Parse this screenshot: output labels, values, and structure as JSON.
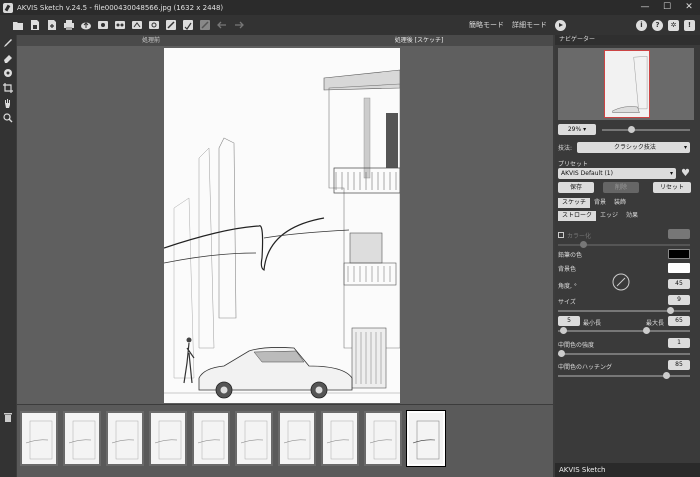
{
  "window": {
    "title": "AKVIS Sketch v.24.5 - file000430048566.jpg (1632 x 2448)",
    "controls": [
      "—",
      "☐",
      "✕"
    ]
  },
  "toolbar": {
    "icons": [
      "open-icon",
      "save-icon",
      "export-icon",
      "print-icon",
      "upload-icon",
      "batch-icon",
      "presets-icon",
      "share-icon",
      "settings-icon",
      "sketch-icon",
      "effect-icon",
      "undo-icon",
      "redo-icon"
    ],
    "mode_express": "簡略モード",
    "mode_advanced": "詳細モード"
  },
  "workspace": {
    "tab_before": "処理前",
    "tab_after": "処理後 [スケッチ]"
  },
  "thumbnails": {
    "count": 10,
    "active_index": 9
  },
  "panel": {
    "navigator_title": "ナビゲーター",
    "zoom_value": "29%",
    "style_label": "技法:",
    "style_value": "クラシック技法",
    "preset_label": "プリセット",
    "preset_value": "AKVIS Default (1)",
    "save_btn": "保存",
    "delete_btn": "削除",
    "reset_btn": "リセット",
    "main_tabs": [
      "スケッチ",
      "背景",
      "装飾"
    ],
    "sub_tabs": [
      "ストローク",
      "エッジ",
      "効果"
    ],
    "color_mode_label": "カラー化",
    "pencil_color_label": "鉛筆の色",
    "bg_color_label": "背景色",
    "angle_label": "角度, °",
    "angle_value": "45",
    "size_label": "サイズ",
    "size_value": "9",
    "min_length_value": "5",
    "min_length_label": "最小長",
    "max_length_label": "最大長",
    "max_length_value": "65",
    "midtone_intensity_label": "中間色の強度",
    "midtone_intensity_value": "1",
    "midtone_hatching_label": "中間色のハッチング",
    "midtone_hatching_value": "85",
    "footer": "AKVIS Sketch",
    "colors": {
      "pencil": "#000000",
      "background": "#ffffff"
    }
  }
}
